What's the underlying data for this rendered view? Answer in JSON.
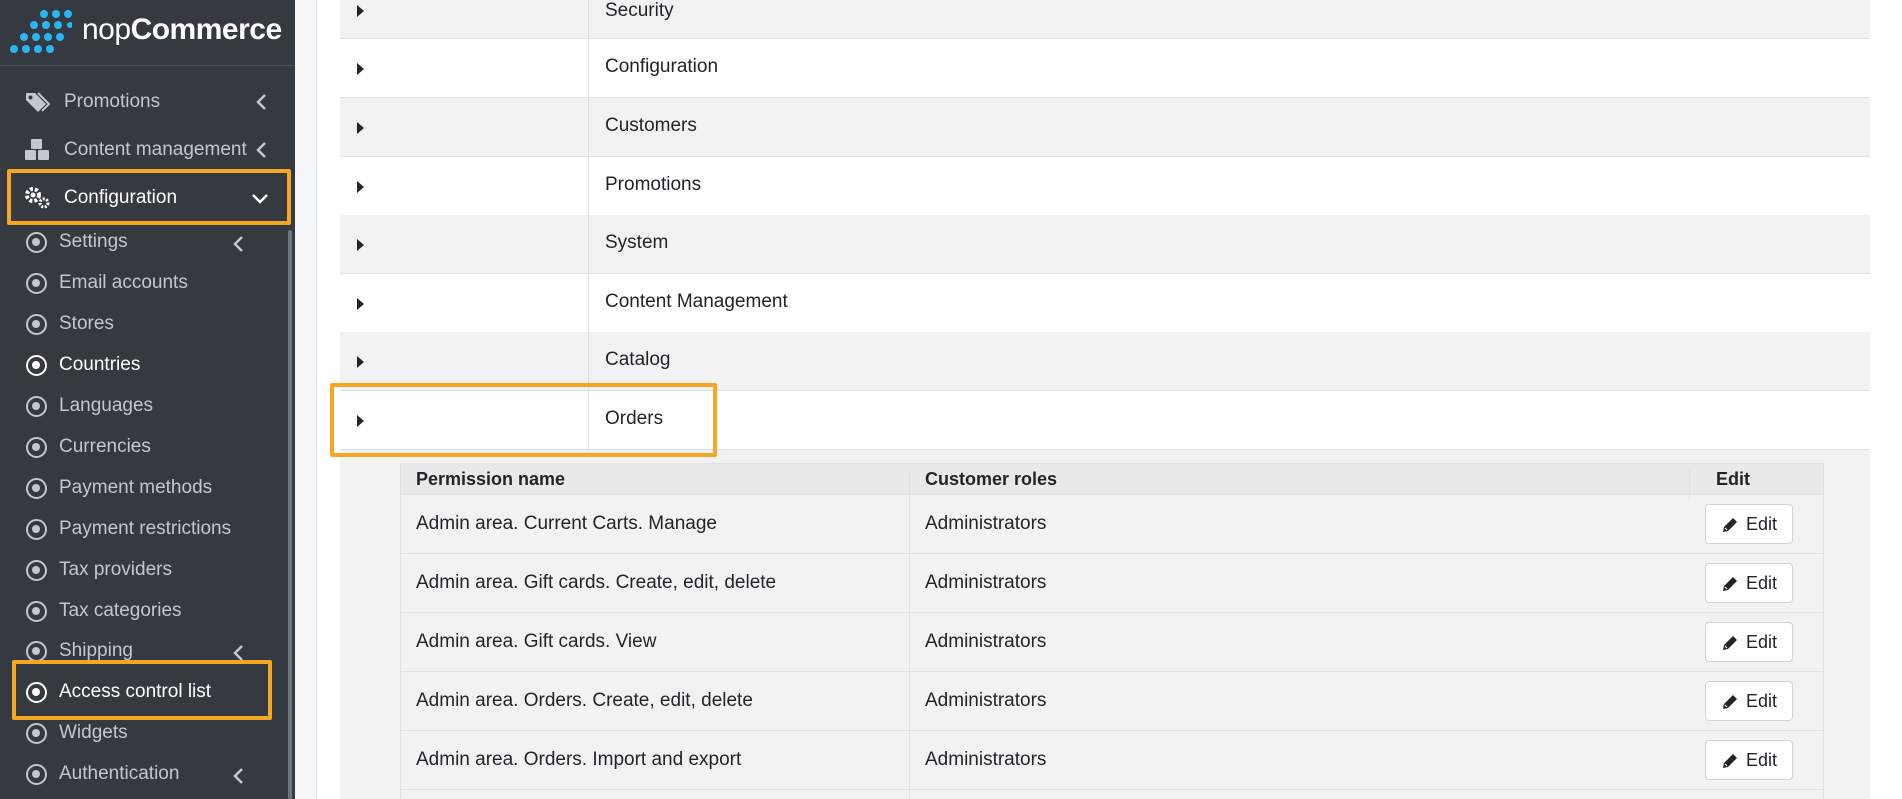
{
  "app": {
    "logo_prefix": "nop",
    "logo_suffix": "Commerce"
  },
  "sidebar": {
    "menu": [
      {
        "label": "Promotions",
        "icon": "tags-icon"
      },
      {
        "label": "Content management",
        "icon": "cubes-icon"
      },
      {
        "label": "Configuration",
        "icon": "gears-icon"
      }
    ],
    "submenu": [
      {
        "label": "Settings",
        "has_children": true
      },
      {
        "label": "Email accounts"
      },
      {
        "label": "Stores"
      },
      {
        "label": "Countries"
      },
      {
        "label": "Languages"
      },
      {
        "label": "Currencies"
      },
      {
        "label": "Payment methods"
      },
      {
        "label": "Payment restrictions"
      },
      {
        "label": "Tax providers"
      },
      {
        "label": "Tax categories"
      },
      {
        "label": "Shipping",
        "has_children": true
      },
      {
        "label": "Access control list"
      },
      {
        "label": "Widgets"
      },
      {
        "label": "Authentication",
        "has_children": true
      }
    ]
  },
  "groups": [
    {
      "name": "Security"
    },
    {
      "name": "Configuration"
    },
    {
      "name": "Customers"
    },
    {
      "name": "Promotions"
    },
    {
      "name": "System"
    },
    {
      "name": "Content Management"
    },
    {
      "name": "Catalog"
    },
    {
      "name": "Orders"
    }
  ],
  "permissions": {
    "headers": {
      "name": "Permission name",
      "roles": "Customer roles",
      "edit": "Edit"
    },
    "rows": [
      {
        "name": "Admin area. Current Carts. Manage",
        "roles": "Administrators",
        "edit": "Edit"
      },
      {
        "name": "Admin area. Gift cards. Create, edit, delete",
        "roles": "Administrators",
        "edit": "Edit"
      },
      {
        "name": "Admin area. Gift cards. View",
        "roles": "Administrators",
        "edit": "Edit"
      },
      {
        "name": "Admin area. Orders. Create, edit, delete",
        "roles": "Administrators",
        "edit": "Edit"
      },
      {
        "name": "Admin area. Orders. Import and export",
        "roles": "Administrators",
        "edit": "Edit"
      }
    ]
  },
  "colors": {
    "sidebar_bg": "#343a40",
    "highlight": "#f5a623",
    "logo_accent": "#29b6f6"
  }
}
